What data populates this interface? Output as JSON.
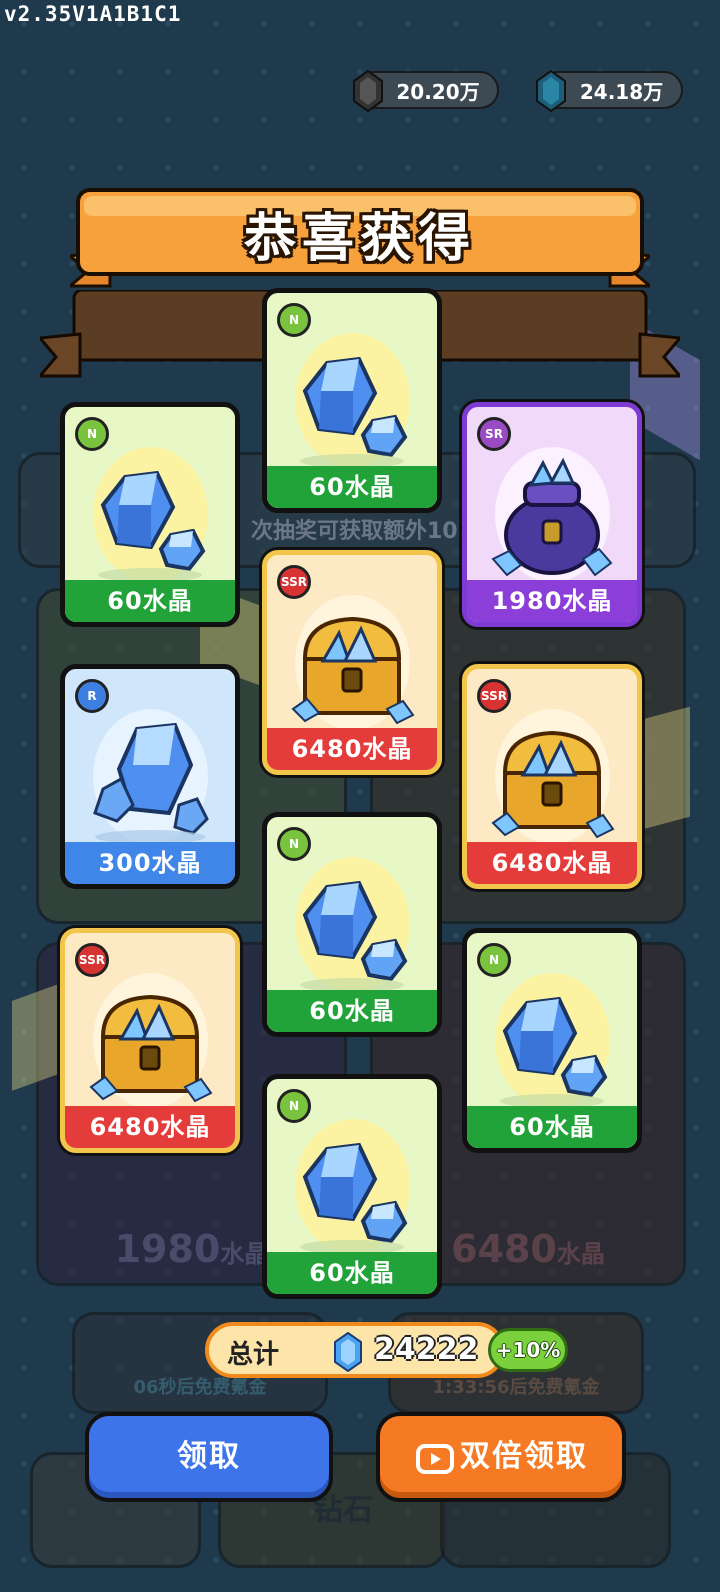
{
  "version": "v2.35V1A1B1C1",
  "resources": {
    "gold": "20.20万",
    "crystal": "24.18万"
  },
  "dialog": {
    "title": "恭喜获得"
  },
  "cards": [
    {
      "rarity": "N",
      "label": "60水晶",
      "art": "crystal"
    },
    {
      "rarity": "N",
      "label": "60水晶",
      "art": "crystal"
    },
    {
      "rarity": "SR",
      "label": "1980水晶",
      "art": "bag"
    },
    {
      "rarity": "SSR",
      "label": "6480水晶",
      "art": "chest"
    },
    {
      "rarity": "R",
      "label": "300水晶",
      "art": "crystal-big"
    },
    {
      "rarity": "SSR",
      "label": "6480水晶",
      "art": "chest"
    },
    {
      "rarity": "N",
      "label": "60水晶",
      "art": "crystal"
    },
    {
      "rarity": "SSR",
      "label": "6480水晶",
      "art": "chest"
    },
    {
      "rarity": "N",
      "label": "60水晶",
      "art": "crystal"
    },
    {
      "rarity": "N",
      "label": "60水晶",
      "art": "crystal"
    }
  ],
  "total": {
    "label": "总计",
    "value": "24222",
    "bonus": "+10%"
  },
  "buttons": {
    "claim": "领取",
    "double_claim": "双倍领取"
  },
  "background": {
    "desc_line": "次抽奖可获取额外10",
    "bottom_left_value": "1980",
    "bottom_right_value": "6480",
    "unit": "水晶",
    "left_button_timer": "06秒后免费氪金",
    "right_button_timer": "1:33:56后免费氪金",
    "bottom_left_label": "钻石"
  },
  "colors": {
    "N": "#22a33a",
    "R": "#3f86e8",
    "SR": "#8c3fd8",
    "SSR": "#e43b3b",
    "accent": "#f57a23",
    "primary": "#3d74ea"
  }
}
